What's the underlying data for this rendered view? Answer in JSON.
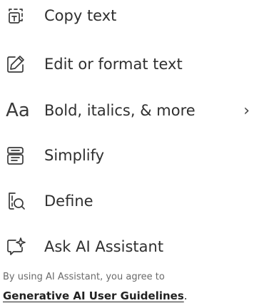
{
  "menu": {
    "items": [
      {
        "label": "Copy text",
        "icon": "copy-text-icon"
      },
      {
        "label": "Edit or format text",
        "icon": "edit-text-icon"
      },
      {
        "label": "Bold, italics, & more",
        "icon": "text-formatting-icon",
        "icon_text": "Aa",
        "has_submenu": true,
        "submenu_indicator": "›"
      },
      {
        "label": "Simplify",
        "icon": "simplify-icon"
      },
      {
        "label": "Define",
        "icon": "define-icon"
      },
      {
        "label": "Ask AI Assistant",
        "icon": "ai-assistant-icon"
      }
    ]
  },
  "footer": {
    "notice": "By using AI Assistant, you agree to",
    "link_text": "Generative AI User Guidelines",
    "link_suffix": "."
  }
}
